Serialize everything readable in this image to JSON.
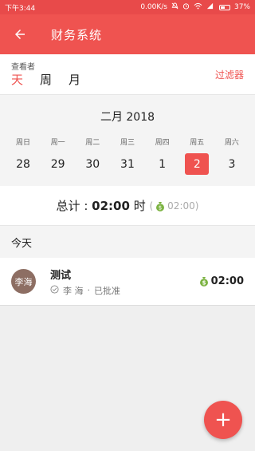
{
  "status_bar": {
    "time": "下午3:44",
    "network_speed": "0.00K/s",
    "battery": "37%",
    "icons": [
      "bell-off-icon",
      "alarm-icon",
      "wifi-icon",
      "signal-icon",
      "battery-icon"
    ]
  },
  "app_bar": {
    "title": "财务系统",
    "back_icon": "arrow-left-icon",
    "color": "#ef5350"
  },
  "view_selector": {
    "label": "查看者",
    "tabs": [
      {
        "label": "天",
        "active": true
      },
      {
        "label": "周",
        "active": false
      },
      {
        "label": "月",
        "active": false
      }
    ],
    "filter_label": "过滤器"
  },
  "calendar": {
    "month_label": "二月 2018",
    "weekdays": [
      "周日",
      "周一",
      "周二",
      "周三",
      "周四",
      "周五",
      "周六"
    ],
    "dates": [
      "28",
      "29",
      "30",
      "31",
      "1",
      "2",
      "3"
    ],
    "selected_date": "2"
  },
  "summary": {
    "prefix": "总计 :",
    "total_time": "02:00",
    "unit": "时",
    "open_paren": "(",
    "billable_time": "02:00",
    "close_paren": ")"
  },
  "section_header": "今天",
  "entries": [
    {
      "avatar_text": "李海",
      "title": "测试",
      "user": "李 海",
      "separator": "·",
      "status": "已批准",
      "amount": "02:00"
    }
  ],
  "fab": {
    "label": "+"
  },
  "colors": {
    "accent": "#ef5350",
    "status_bar": "#e84a4a",
    "money_green": "#7cb342",
    "avatar": "#8d6e63"
  }
}
